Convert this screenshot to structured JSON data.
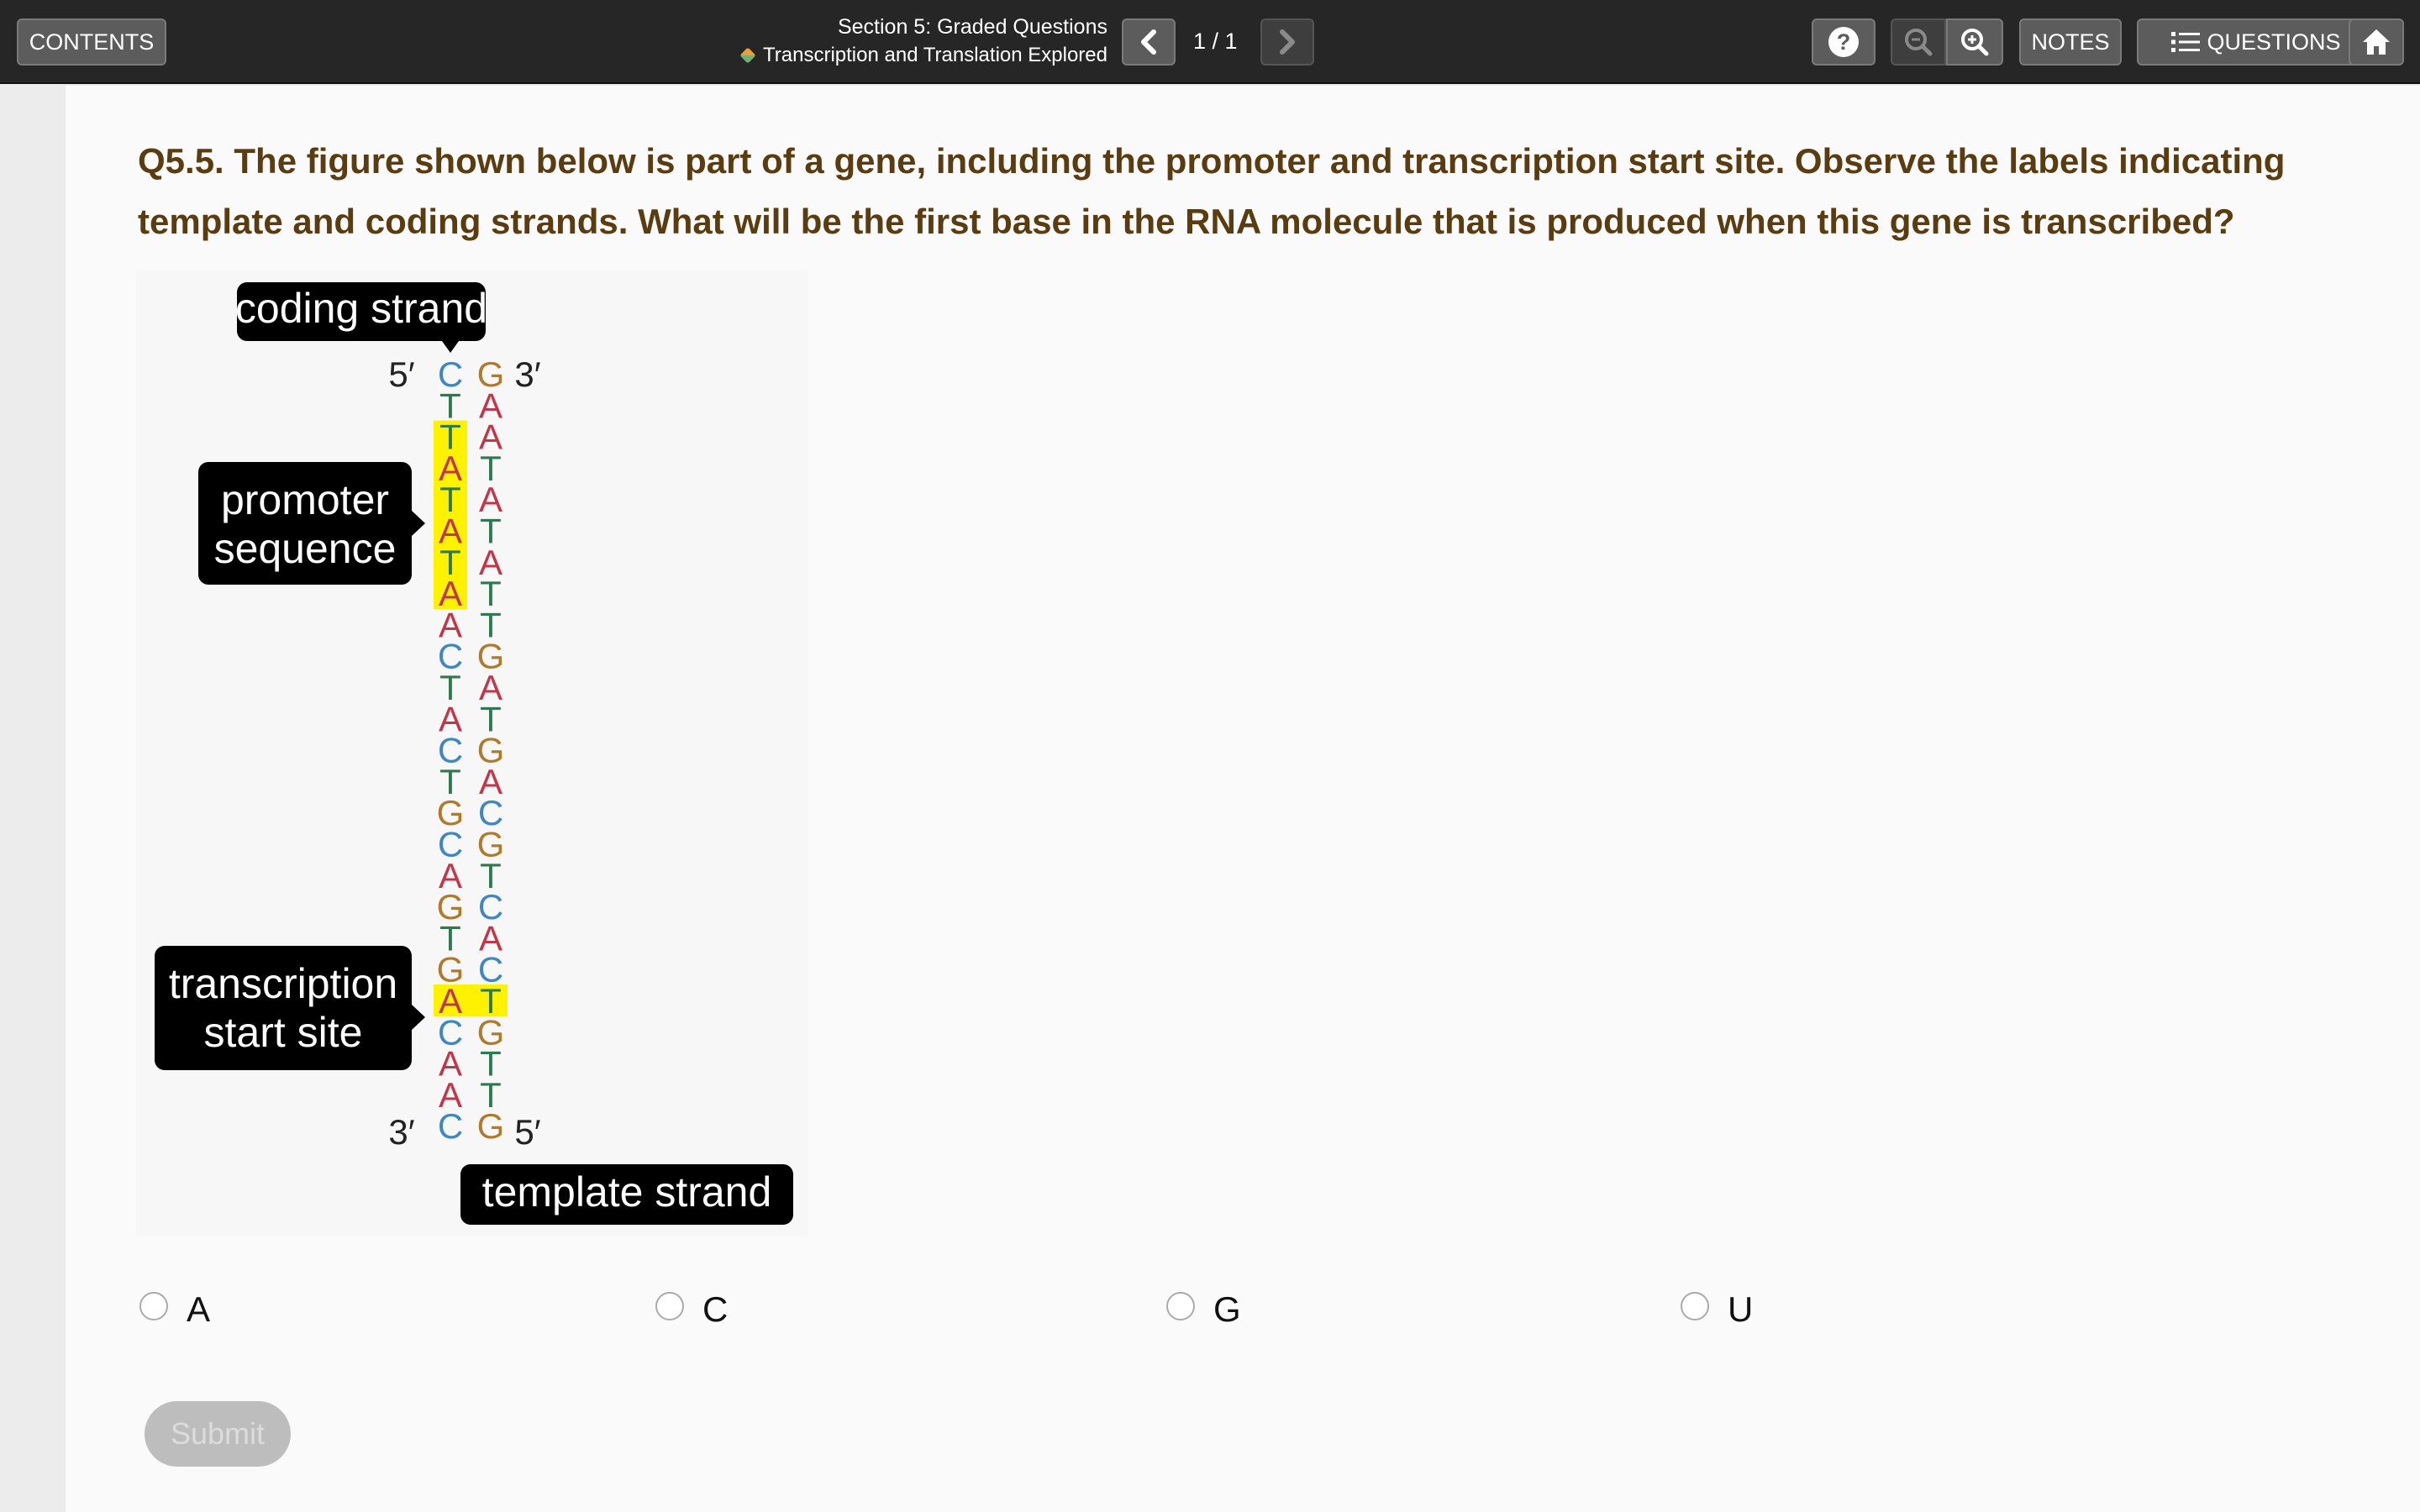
{
  "toolbar": {
    "contents_label": "CONTENTS",
    "section_title": "Section 5: Graded Questions",
    "section_subtitle": "Transcription and Translation Explored",
    "page_indicator": "1 / 1",
    "notes_label": "NOTES",
    "questions_label": "QUESTIONS",
    "icons": {
      "prev": "chevron-left-icon",
      "next": "chevron-right-icon",
      "help": "question-mark-icon",
      "zoom_out": "zoom-out-icon",
      "zoom_in": "zoom-in-icon",
      "questions": "list-icon",
      "home": "home-icon"
    }
  },
  "question": {
    "text": "Q5.5. The figure shown below is part of a gene, including the promoter and transcription start site. Observe the labels indicating template and coding strands. What will be the first base in the RNA molecule that is produced when this gene is transcribed?"
  },
  "figure": {
    "labels": {
      "coding_strand": "coding strand",
      "promoter_line1": "promoter",
      "promoter_line2": "sequence",
      "tss_line1": "transcription",
      "tss_line2": "start site",
      "template_strand": "template strand"
    },
    "ends": {
      "coding_top": "5′",
      "template_top": "3′",
      "coding_bottom": "3′",
      "template_bottom": "5′"
    },
    "coding_bases": [
      "C",
      "T",
      "T",
      "A",
      "T",
      "A",
      "T",
      "A",
      "A",
      "C",
      "T",
      "A",
      "C",
      "T",
      "G",
      "C",
      "A",
      "G",
      "T",
      "G",
      "A",
      "C",
      "A",
      "A",
      "C"
    ],
    "template_bases": [
      "G",
      "A",
      "A",
      "T",
      "A",
      "T",
      "A",
      "T",
      "T",
      "G",
      "A",
      "T",
      "G",
      "A",
      "C",
      "G",
      "T",
      "C",
      "A",
      "C",
      "T",
      "G",
      "T",
      "T",
      "G"
    ],
    "highlight_coding_rows": [
      2,
      3,
      4,
      5,
      6,
      7
    ],
    "highlight_tss_row": 20,
    "base_colors": {
      "A": "#c0364a",
      "T": "#2e7a4e",
      "C": "#3f86c4",
      "G": "#b07a2c"
    },
    "highlight_color": "#fff200"
  },
  "answers": {
    "options": [
      {
        "label": "A"
      },
      {
        "label": "C"
      },
      {
        "label": "G"
      },
      {
        "label": "U"
      }
    ],
    "submit_label": "Submit"
  }
}
